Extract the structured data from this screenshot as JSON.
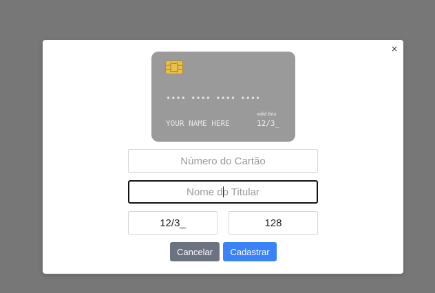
{
  "modal": {
    "close_label": "×"
  },
  "card_preview": {
    "number": "•••• •••• •••• ••••",
    "holder_name": "YOUR NAME HERE",
    "valid_label": "valid thru",
    "expiry": "12/3_"
  },
  "form": {
    "card_number": {
      "value": "",
      "placeholder": "Número do Cartão"
    },
    "holder_name": {
      "value": "",
      "placeholder": "Nome do Titular"
    },
    "expiry": {
      "value": "12/3_",
      "placeholder": ""
    },
    "cvv": {
      "value": "128",
      "placeholder": ""
    },
    "cancel_label": "Cancelar",
    "submit_label": "Cadastrar"
  },
  "colors": {
    "backdrop": "#777777",
    "card_bg": "#9a9a9a",
    "chip": "#e8c04a",
    "cancel_button": "#6b7280",
    "submit_button": "#3b82f6",
    "focused_border": "#111111"
  },
  "icons": {
    "chip": "card-chip-icon"
  }
}
